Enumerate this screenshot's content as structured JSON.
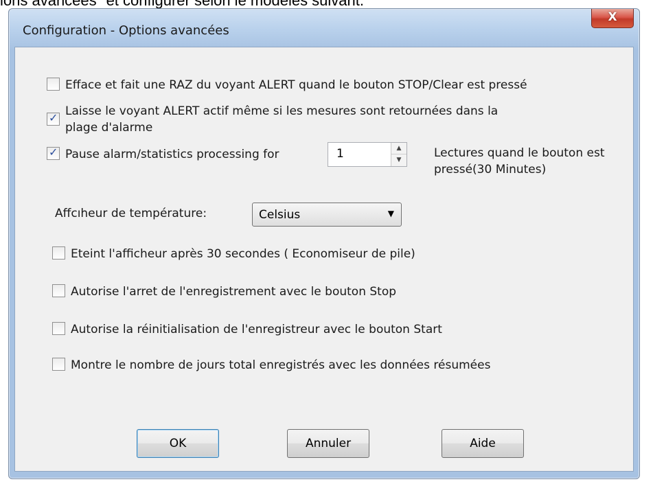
{
  "document": {
    "partial_text": "ions avancées\" et configurer selon le modèles suivant."
  },
  "window": {
    "title": "Configuration  - Options avancées",
    "close_label": "X"
  },
  "options": {
    "clear_alert": {
      "label": "Efface et fait une RAZ du voyant ALERT quand le bouton STOP/Clear est pressé",
      "checked": false
    },
    "keep_alert": {
      "label_line1": "Laisse le voyant ALERT actif  même si les mesures sont retournées dans la",
      "label_line2": "plage d'alarme",
      "checked": true
    },
    "pause": {
      "label": "Pause alarm/statistics processing for",
      "checked": true,
      "value": "1",
      "suffix_line1": "Lectures quand le bouton est",
      "suffix_line2": "pressé(30 Minutes)"
    },
    "temperature": {
      "label": "Affcıheur de température:",
      "selected": "Celsius"
    },
    "display_off": {
      "label": "Eteint l'afficheur après 30 secondes ( Economiseur de pile)",
      "checked": false
    },
    "stop_button": {
      "label": "Autorise l'arret de l'enregistrement avec le bouton Stop",
      "checked": false
    },
    "start_button": {
      "label": "Autorise la réinitialisation de l'enregistreur avec le bouton Start",
      "checked": false
    },
    "total_days": {
      "label": "Montre le nombre de jours total enregistrés avec les données résumées",
      "checked": false
    }
  },
  "buttons": {
    "ok": "OK",
    "cancel": "Annuler",
    "help": "Aide"
  }
}
